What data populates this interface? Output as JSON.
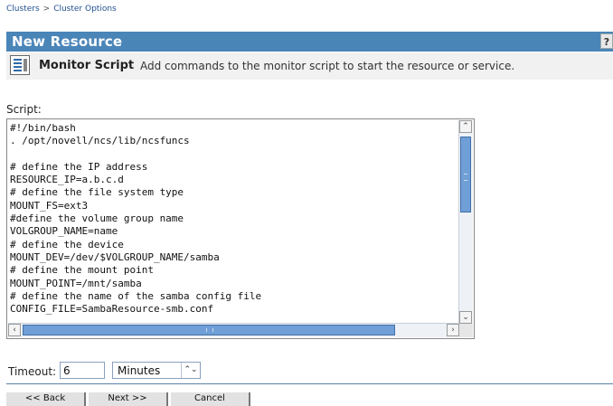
{
  "breadcrumb": {
    "items": [
      "Clusters",
      "Cluster Options"
    ],
    "separator": ">"
  },
  "titlebar": {
    "title": "New Resource",
    "help_label": "?"
  },
  "header": {
    "title": "Monitor Script",
    "description": "Add commands to the monitor script to start the resource or service.",
    "icon": "script-document-icon"
  },
  "script": {
    "label": "Script:",
    "content": "#!/bin/bash\n. /opt/novell/ncs/lib/ncsfuncs\n\n# define the IP address\nRESOURCE_IP=a.b.c.d\n# define the file system type\nMOUNT_FS=ext3\n#define the volume group name\nVOLGROUP_NAME=name\n# define the device\nMOUNT_DEV=/dev/$VOLGROUP_NAME/samba\n# define the mount point\nMOUNT_POINT=/mnt/samba\n# define the name of the samba config file\nCONFIG_FILE=SambaResource-smb.conf"
  },
  "timeout": {
    "label": "Timeout:",
    "value": "6",
    "unit": "Minutes"
  },
  "nav": {
    "back": "<< Back",
    "next": "Next >>",
    "cancel": "Cancel"
  },
  "colors": {
    "titlebar": "#4a85b8",
    "header_bg": "#f1f1f1",
    "scroll_thumb": "#6f9fd6"
  }
}
